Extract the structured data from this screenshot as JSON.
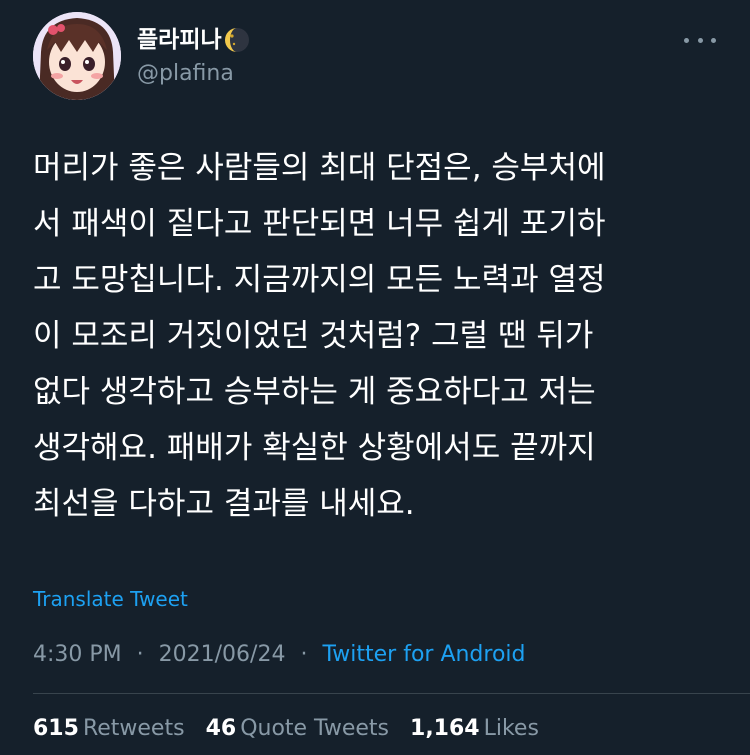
{
  "colors": {
    "background": "#15202b",
    "primary_text": "#ffffff",
    "secondary_text": "#8899a6",
    "accent": "#1da1f2",
    "divider": "#38444d"
  },
  "author": {
    "display_name": "플라피나",
    "handle": "@plafina",
    "avatar_icon": "anime-girl-avatar",
    "name_emoji_icon": "moon-icon"
  },
  "tweet": {
    "lines": [
      "머리가 좋은 사람들의 최대 단점은, 승부처에",
      "서 패색이 짙다고 판단되면 너무 쉽게 포기하",
      "고 도망칩니다. 지금까지의 모든 노력과 열정",
      "이 모조리 거짓이었던 것처럼? 그럴 땐 뒤가",
      "없다 생각하고 승부하는 게 중요하다고 저는",
      "생각해요. 패배가 확실한 상황에서도 끝까지",
      "최선을 다하고 결과를 내세요."
    ],
    "translate_label": "Translate Tweet",
    "time": "4:30 PM",
    "date": "2021/06/24",
    "separator": "·",
    "source": "Twitter for Android"
  },
  "stats": {
    "retweets_count": "615",
    "retweets_label": "Retweets",
    "quotes_count": "46",
    "quotes_label": "Quote Tweets",
    "likes_count": "1,164",
    "likes_label": "Likes"
  }
}
